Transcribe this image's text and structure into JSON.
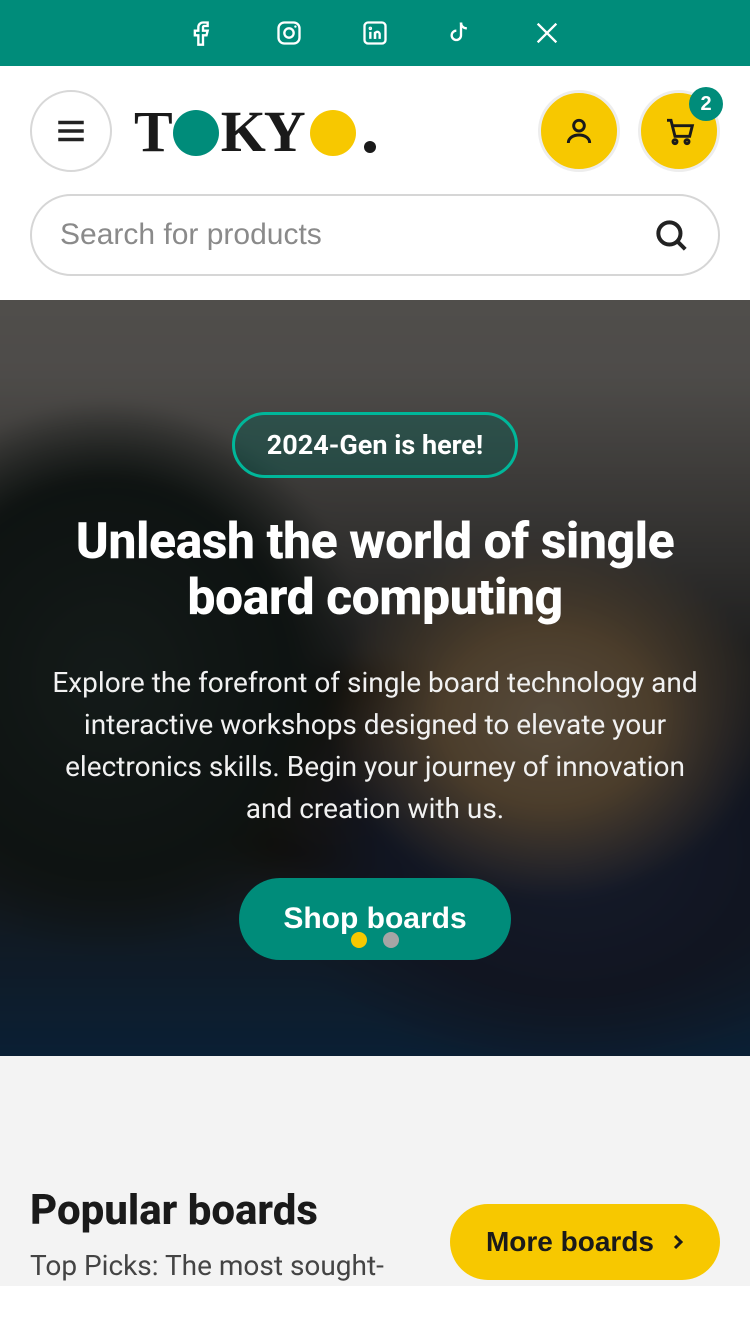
{
  "social": {
    "icons": [
      "facebook",
      "instagram",
      "linkedin",
      "tiktok",
      "x-twitter"
    ]
  },
  "header": {
    "logo_text": "TOKYO",
    "cart_count": "2"
  },
  "search": {
    "placeholder": "Search for products"
  },
  "hero": {
    "tag": "2024-Gen is here!",
    "title": "Unleash the world of single board computing",
    "description": "Explore the forefront of single board technology and interactive workshops designed to elevate your electronics skills. Begin your journey of innovation and creation with us.",
    "cta_label": "Shop boards",
    "slides_count": 2,
    "active_slide": 1
  },
  "popular": {
    "title": "Popular boards",
    "subtitle": "Top Picks: The most sought-",
    "more_label": "More boards"
  },
  "colors": {
    "brand_teal": "#008c7a",
    "brand_yellow": "#f7c800"
  }
}
